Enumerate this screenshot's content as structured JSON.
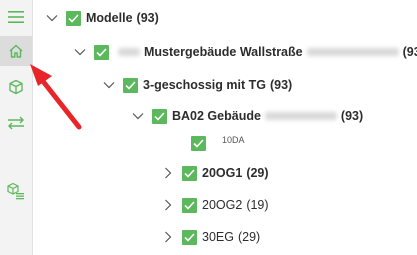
{
  "sidebar": {
    "items": [
      {
        "name": "menu-icon"
      },
      {
        "name": "home-icon",
        "active": true
      },
      {
        "name": "cube-icon"
      },
      {
        "name": "swap-arrows-icon"
      },
      {
        "name": "cube-list-icon"
      }
    ]
  },
  "tree": {
    "root": {
      "label": "Modelle",
      "count": "(93)"
    },
    "building": {
      "label": "Mustergebäude Wallstraße",
      "count": "(93)"
    },
    "floors": {
      "label": "3-geschossig mit TG",
      "count": "(93)"
    },
    "ba": {
      "label": "BA02 Gebäude",
      "count": "(93)"
    },
    "leaf": {
      "label": "10DA"
    },
    "og1": {
      "label": "20OG1",
      "count": "(29)"
    },
    "og2": {
      "label": "20OG2",
      "count": "(19)"
    },
    "eg": {
      "label": "30EG",
      "count": "(29)"
    }
  },
  "colors": {
    "accent_green": "#5cb85c",
    "annotation_arrow": "#e8262a",
    "sidebar_bg": "#f3f3f3"
  }
}
